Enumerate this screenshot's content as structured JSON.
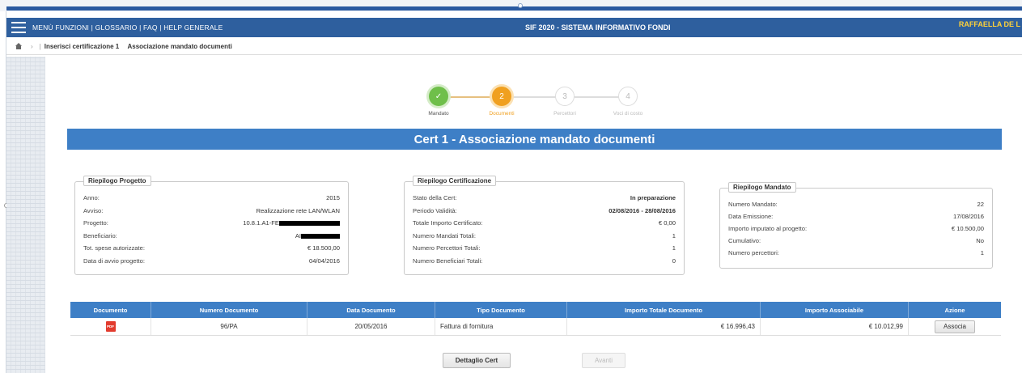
{
  "header": {
    "menu_links": "MENÙ FUNZIONI | GLOSSARIO | FAQ | HELP GENERALE",
    "app_title": "SIF 2020 - SISTEMA INFORMATIVO FONDI",
    "user_name": "RAFFAELLA DE L"
  },
  "breadcrumb": {
    "items": [
      "Inserisci certificazione 1",
      "Associazione mandato documenti"
    ]
  },
  "stepper": {
    "steps": [
      {
        "label": "Mandato",
        "symbol": "✓",
        "state": "done"
      },
      {
        "label": "Documenti",
        "symbol": "2",
        "state": "active"
      },
      {
        "label": "Percettori",
        "symbol": "3",
        "state": "todo"
      },
      {
        "label": "Voci di costo",
        "symbol": "4",
        "state": "todo"
      }
    ]
  },
  "banner_title": "Cert 1 - Associazione mandato documenti",
  "progetto": {
    "title": "Riepilogo Progetto",
    "rows": [
      {
        "k": "Anno:",
        "v": "2015"
      },
      {
        "k": "Avviso:",
        "v": "Realizzazione rete LAN/WLAN"
      },
      {
        "k": "Progetto:",
        "v": "10.8.1.A1-FE"
      },
      {
        "k": "Beneficiario:",
        "v": "AI"
      },
      {
        "k": "Tot. spese autorizzate:",
        "v": "€ 18.500,00"
      },
      {
        "k": "Data di avvio progetto:",
        "v": "04/04/2016"
      }
    ]
  },
  "certificazione": {
    "title": "Riepilogo Certificazione",
    "rows": [
      {
        "k": "Stato della Cert:",
        "v": "In preparazione"
      },
      {
        "k": "Periodo Validità:",
        "v": "02/08/2016 - 28/08/2016"
      },
      {
        "k": "Totale Importo Certificato:",
        "v": "€ 0,00"
      },
      {
        "k": "Numero Mandati Totali:",
        "v": "1"
      },
      {
        "k": "Numero Percettori Totali:",
        "v": "1"
      },
      {
        "k": "Numero Beneficiari Totali:",
        "v": "0"
      }
    ]
  },
  "mandato": {
    "title": "Riepilogo Mandato",
    "rows": [
      {
        "k": "Numero Mandato:",
        "v": "22"
      },
      {
        "k": "Data Emissione:",
        "v": "17/08/2016"
      },
      {
        "k": "Importo imputato al progetto:",
        "v": "€ 10.500,00"
      },
      {
        "k": "Cumulativo:",
        "v": "No"
      },
      {
        "k": "Numero percettori:",
        "v": "1"
      }
    ]
  },
  "table": {
    "headers": [
      "Documento",
      "Numero Documento",
      "Data Documento",
      "Tipo Documento",
      "Importo Totale Documento",
      "Importo Associabile",
      "Azione"
    ],
    "rows": [
      {
        "doc_icon": "PDF",
        "numero": "96/PA",
        "data": "20/05/2016",
        "tipo": "Fattura di fornitura",
        "importo_totale": "€ 16.996,43",
        "importo_associabile": "€ 10.012,99",
        "azione": "Associa"
      }
    ]
  },
  "footer": {
    "dettaglio_label": "Dettaglio Cert",
    "avanti_label": "Avanti"
  },
  "colors": {
    "header_blue": "#2e5f9e",
    "banner_blue": "#3e7fc6",
    "step_done": "#6fbf4a",
    "step_active": "#f0a020",
    "user_name": "#ffd23a"
  }
}
